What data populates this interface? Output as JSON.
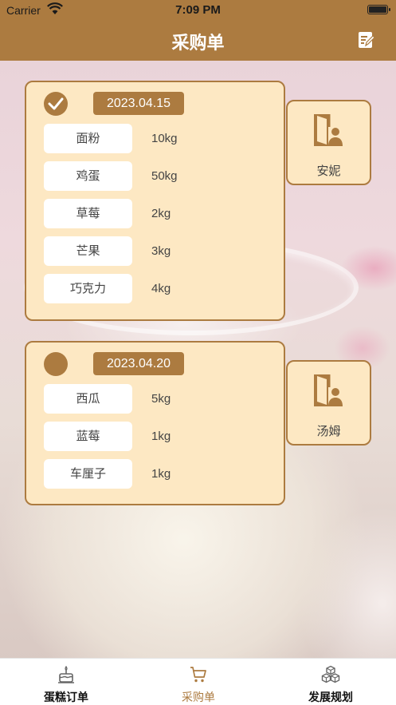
{
  "status_bar": {
    "carrier": "Carrier",
    "time": "7:09 PM"
  },
  "header": {
    "title": "采购单",
    "edit_icon": "edit-note-icon"
  },
  "orders": [
    {
      "checked": true,
      "date": "2023.04.15",
      "items": [
        {
          "name": "面粉",
          "qty": "10kg"
        },
        {
          "name": "鸡蛋",
          "qty": "50kg"
        },
        {
          "name": "草莓",
          "qty": "2kg"
        },
        {
          "name": "芒果",
          "qty": "3kg"
        },
        {
          "name": "巧克力",
          "qty": "4kg"
        }
      ],
      "assignee": "安妮"
    },
    {
      "checked": false,
      "date": "2023.04.20",
      "items": [
        {
          "name": "西瓜",
          "qty": "5kg"
        },
        {
          "name": "蓝莓",
          "qty": "1kg"
        },
        {
          "name": "车厘子",
          "qty": "1kg"
        }
      ],
      "assignee": "汤姆"
    }
  ],
  "tabs": [
    {
      "label": "蛋糕订单",
      "icon": "cake-icon"
    },
    {
      "label": "采购单",
      "icon": "cart-icon"
    },
    {
      "label": "发展规划",
      "icon": "cubes-icon"
    }
  ],
  "colors": {
    "brand": "#ac7b40",
    "card": "#fde8c3"
  }
}
